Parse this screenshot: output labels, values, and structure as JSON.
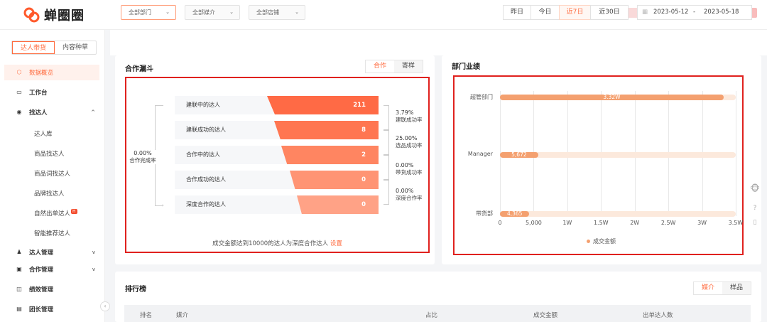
{
  "brand": {
    "name": "蝉圈圈"
  },
  "sidebar": {
    "tabs": [
      {
        "label": "达人带货"
      },
      {
        "label": "内容种草"
      }
    ],
    "items": {
      "overview": "数据概览",
      "workbench": "工作台",
      "find": "找达人",
      "sub": [
        "达人库",
        "商品找达人",
        "商品词找达人",
        "品牌找达人",
        "自然出单达人",
        "智能推荐达人"
      ],
      "hot_badge": "H",
      "manage": "达人管理",
      "coop": "合作管理",
      "perf": "绩效管理",
      "team": "团长管理"
    }
  },
  "filters": {
    "department": "全部部门",
    "media": "全部媒介",
    "store": "全部店铺",
    "time": [
      "昨日",
      "今日",
      "近7日",
      "近30日"
    ],
    "date_start": "2023-05-12",
    "date_sep": "-",
    "date_end": "2023-05-18"
  },
  "funnel": {
    "title": "合作漏斗",
    "tabs": [
      "合作",
      "寄样"
    ],
    "stages": [
      {
        "name": "建联中的达人",
        "value": "211"
      },
      {
        "name": "建联成功的达人",
        "value": "8"
      },
      {
        "name": "合作中的达人",
        "value": "2"
      },
      {
        "name": "合作成功的达人",
        "value": "0"
      },
      {
        "name": "深度合作的达人",
        "value": "0"
      }
    ],
    "rates": [
      {
        "pct": "3.79%",
        "label": "建联成功率"
      },
      {
        "pct": "25.00%",
        "label": "选品成功率"
      },
      {
        "pct": "0.00%",
        "label": "带货成功率"
      },
      {
        "pct": "0.00%",
        "label": "深度合作率"
      }
    ],
    "overall": {
      "pct": "0.00%",
      "label": "合作完成率"
    },
    "footer": "成交金额达到10000的达人为深度合作达人",
    "footer_link": "设置"
  },
  "dept_chart": {
    "title": "部门业绩",
    "legend": "成交金额",
    "bar_labels": [
      "3.32W",
      "5,672",
      "4,365"
    ]
  },
  "chart_data": {
    "type": "bar",
    "orientation": "horizontal",
    "title": "部门业绩",
    "categories": [
      "超管部门",
      "Manager",
      "带货部"
    ],
    "series": [
      {
        "name": "成交金额",
        "values": [
          33200,
          5672,
          4365
        ]
      }
    ],
    "xlim": [
      0,
      35000
    ],
    "x_ticks": [
      "0",
      "5,000",
      "1W",
      "1.5W",
      "2W",
      "2.5W",
      "3W",
      "3.5W"
    ],
    "grid": true,
    "legend_position": "bottom",
    "colors": {
      "bar": "#f4a06f",
      "track": "#fce9dc"
    }
  },
  "ranking": {
    "title": "排行榜",
    "tabs": [
      "媒介",
      "样品"
    ],
    "columns": [
      "排名",
      "媒介",
      "占比",
      "成交金额",
      "出单达人数"
    ]
  },
  "colors": {
    "accent": "#ff6a3d",
    "highlight_border": "#e0211e"
  }
}
